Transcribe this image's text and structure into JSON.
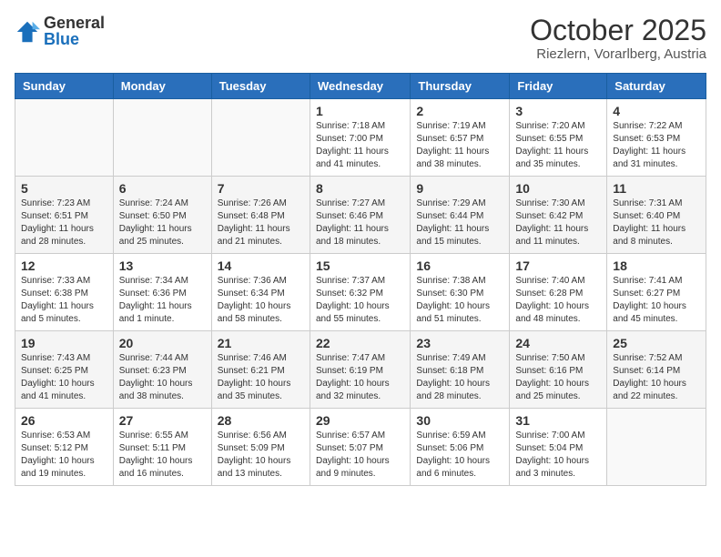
{
  "logo": {
    "general": "General",
    "blue": "Blue"
  },
  "title": "October 2025",
  "location": "Riezlern, Vorarlberg, Austria",
  "headers": [
    "Sunday",
    "Monday",
    "Tuesday",
    "Wednesday",
    "Thursday",
    "Friday",
    "Saturday"
  ],
  "weeks": [
    [
      {
        "day": "",
        "info": ""
      },
      {
        "day": "",
        "info": ""
      },
      {
        "day": "",
        "info": ""
      },
      {
        "day": "1",
        "info": "Sunrise: 7:18 AM\nSunset: 7:00 PM\nDaylight: 11 hours and 41 minutes."
      },
      {
        "day": "2",
        "info": "Sunrise: 7:19 AM\nSunset: 6:57 PM\nDaylight: 11 hours and 38 minutes."
      },
      {
        "day": "3",
        "info": "Sunrise: 7:20 AM\nSunset: 6:55 PM\nDaylight: 11 hours and 35 minutes."
      },
      {
        "day": "4",
        "info": "Sunrise: 7:22 AM\nSunset: 6:53 PM\nDaylight: 11 hours and 31 minutes."
      }
    ],
    [
      {
        "day": "5",
        "info": "Sunrise: 7:23 AM\nSunset: 6:51 PM\nDaylight: 11 hours and 28 minutes."
      },
      {
        "day": "6",
        "info": "Sunrise: 7:24 AM\nSunset: 6:50 PM\nDaylight: 11 hours and 25 minutes."
      },
      {
        "day": "7",
        "info": "Sunrise: 7:26 AM\nSunset: 6:48 PM\nDaylight: 11 hours and 21 minutes."
      },
      {
        "day": "8",
        "info": "Sunrise: 7:27 AM\nSunset: 6:46 PM\nDaylight: 11 hours and 18 minutes."
      },
      {
        "day": "9",
        "info": "Sunrise: 7:29 AM\nSunset: 6:44 PM\nDaylight: 11 hours and 15 minutes."
      },
      {
        "day": "10",
        "info": "Sunrise: 7:30 AM\nSunset: 6:42 PM\nDaylight: 11 hours and 11 minutes."
      },
      {
        "day": "11",
        "info": "Sunrise: 7:31 AM\nSunset: 6:40 PM\nDaylight: 11 hours and 8 minutes."
      }
    ],
    [
      {
        "day": "12",
        "info": "Sunrise: 7:33 AM\nSunset: 6:38 PM\nDaylight: 11 hours and 5 minutes."
      },
      {
        "day": "13",
        "info": "Sunrise: 7:34 AM\nSunset: 6:36 PM\nDaylight: 11 hours and 1 minute."
      },
      {
        "day": "14",
        "info": "Sunrise: 7:36 AM\nSunset: 6:34 PM\nDaylight: 10 hours and 58 minutes."
      },
      {
        "day": "15",
        "info": "Sunrise: 7:37 AM\nSunset: 6:32 PM\nDaylight: 10 hours and 55 minutes."
      },
      {
        "day": "16",
        "info": "Sunrise: 7:38 AM\nSunset: 6:30 PM\nDaylight: 10 hours and 51 minutes."
      },
      {
        "day": "17",
        "info": "Sunrise: 7:40 AM\nSunset: 6:28 PM\nDaylight: 10 hours and 48 minutes."
      },
      {
        "day": "18",
        "info": "Sunrise: 7:41 AM\nSunset: 6:27 PM\nDaylight: 10 hours and 45 minutes."
      }
    ],
    [
      {
        "day": "19",
        "info": "Sunrise: 7:43 AM\nSunset: 6:25 PM\nDaylight: 10 hours and 41 minutes."
      },
      {
        "day": "20",
        "info": "Sunrise: 7:44 AM\nSunset: 6:23 PM\nDaylight: 10 hours and 38 minutes."
      },
      {
        "day": "21",
        "info": "Sunrise: 7:46 AM\nSunset: 6:21 PM\nDaylight: 10 hours and 35 minutes."
      },
      {
        "day": "22",
        "info": "Sunrise: 7:47 AM\nSunset: 6:19 PM\nDaylight: 10 hours and 32 minutes."
      },
      {
        "day": "23",
        "info": "Sunrise: 7:49 AM\nSunset: 6:18 PM\nDaylight: 10 hours and 28 minutes."
      },
      {
        "day": "24",
        "info": "Sunrise: 7:50 AM\nSunset: 6:16 PM\nDaylight: 10 hours and 25 minutes."
      },
      {
        "day": "25",
        "info": "Sunrise: 7:52 AM\nSunset: 6:14 PM\nDaylight: 10 hours and 22 minutes."
      }
    ],
    [
      {
        "day": "26",
        "info": "Sunrise: 6:53 AM\nSunset: 5:12 PM\nDaylight: 10 hours and 19 minutes."
      },
      {
        "day": "27",
        "info": "Sunrise: 6:55 AM\nSunset: 5:11 PM\nDaylight: 10 hours and 16 minutes."
      },
      {
        "day": "28",
        "info": "Sunrise: 6:56 AM\nSunset: 5:09 PM\nDaylight: 10 hours and 13 minutes."
      },
      {
        "day": "29",
        "info": "Sunrise: 6:57 AM\nSunset: 5:07 PM\nDaylight: 10 hours and 9 minutes."
      },
      {
        "day": "30",
        "info": "Sunrise: 6:59 AM\nSunset: 5:06 PM\nDaylight: 10 hours and 6 minutes."
      },
      {
        "day": "31",
        "info": "Sunrise: 7:00 AM\nSunset: 5:04 PM\nDaylight: 10 hours and 3 minutes."
      },
      {
        "day": "",
        "info": ""
      }
    ]
  ]
}
